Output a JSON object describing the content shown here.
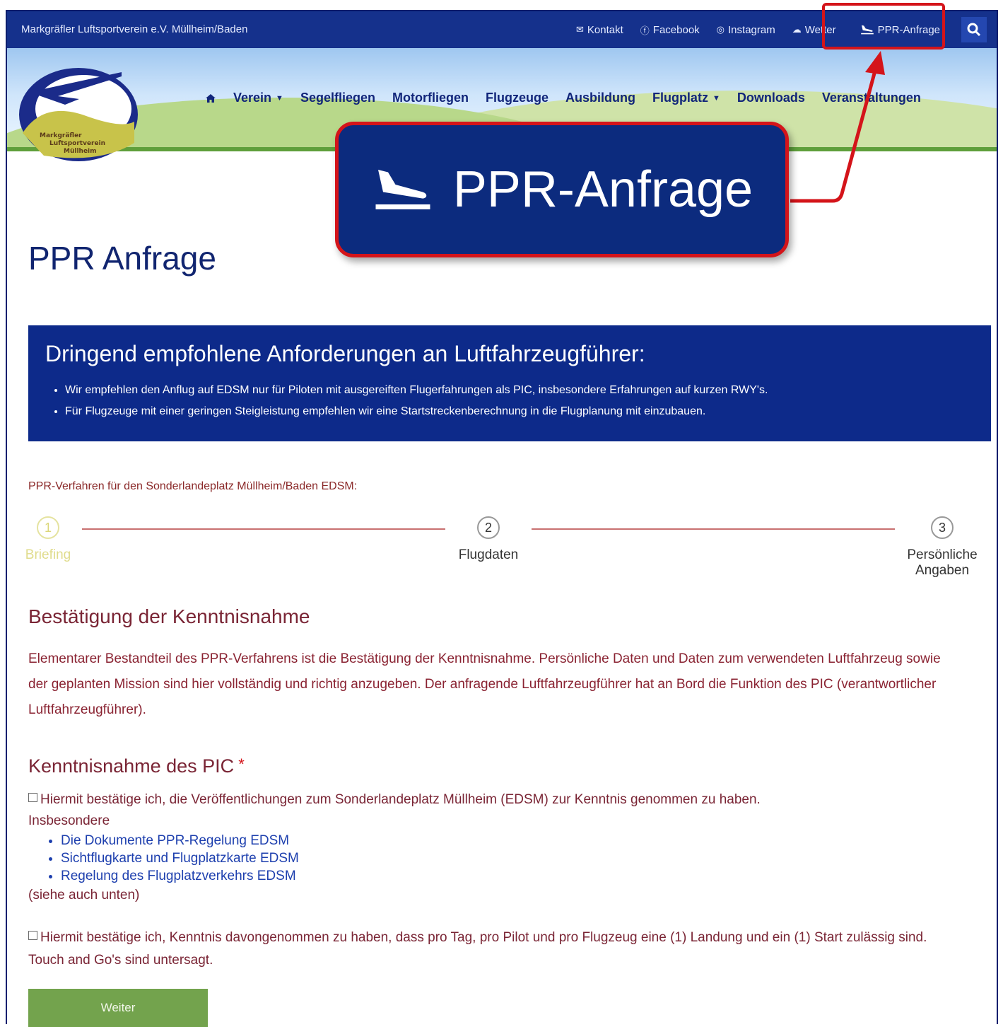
{
  "topbar": {
    "site_title": "Markgräfler Luftsportverein e.V. Müllheim/Baden",
    "links": [
      "Kontakt",
      "Facebook",
      "Instagram",
      "Wetter",
      "PPR-Anfrage"
    ]
  },
  "logo": {
    "text_lines": [
      "Markgräfler",
      "Luftsportverein",
      "Müllheim"
    ]
  },
  "nav": {
    "items": [
      "Verein",
      "Segelfliegen",
      "Motorfliegen",
      "Flugzeuge",
      "Ausbildung",
      "Flugplatz",
      "Downloads",
      "Veranstaltungen"
    ]
  },
  "callout": {
    "label": "PPR-Anfrage"
  },
  "page": {
    "title": "PPR Anfrage"
  },
  "notice": {
    "title": "Dringend empfohlene Anforderungen an Luftfahrzeugführer:",
    "items": [
      "Wir empfehlen den Anflug auf EDSM nur für Piloten mit ausgereiften Flugerfahrungen als PIC, insbesondere Erfahrungen auf kurzen RWY's.",
      "Für Flugzeuge mit einer geringen Steigleistung empfehlen wir eine Startstreckenberechnung in die Flugplanung mit einzubauen."
    ]
  },
  "procedure": "PPR-Verfahren für den Sonderlandeplatz Müllheim/Baden EDSM:",
  "steps": [
    {
      "num": "1",
      "label": "Briefing"
    },
    {
      "num": "2",
      "label": "Flugdaten"
    },
    {
      "num": "3",
      "label": "Persönliche Angaben"
    }
  ],
  "confirmation": {
    "heading": "Bestätigung der Kenntnisnahme",
    "paragraph": "Elementarer Bestandteil des PPR-Verfahrens ist die Bestätigung der Kenntnisnahme. Persönliche Daten und Daten zum verwendeten Luftfahrzeug sowie der geplanten Mission sind hier vollständig und richtig anzugeben. Der anfragende Luftfahrzeugführer hat an Bord die Funktion des PIC (verantwortlicher Luftfahrzeugführer)."
  },
  "pic": {
    "heading": "Kenntnisnahme des PIC",
    "required": "*",
    "check1": "Hiermit bestätige ich, die Veröffentlichungen zum Sonderlandeplatz Müllheim (EDSM) zur Kenntnis genommen zu haben.",
    "insbesondere": "Insbesondere",
    "links": [
      "Die Dokumente PPR-Regelung EDSM",
      "Sichtflugkarte und Flugplatzkarte EDSM",
      "Regelung des Flugplatzverkehrs EDSM"
    ],
    "see_also": "(siehe auch unten)",
    "check2": "Hiermit bestätige ich, Kenntnis davongenommen zu haben, dass pro Tag, pro Pilot und pro Flugzeug eine (1) Landung und ein (1) Start zulässig sind. Touch and Go's sind untersagt."
  },
  "button": {
    "next": "Weiter"
  },
  "colors": {
    "brand_blue": "#15318c",
    "highlight_red": "#d4141a",
    "button_green": "#73a34d"
  }
}
